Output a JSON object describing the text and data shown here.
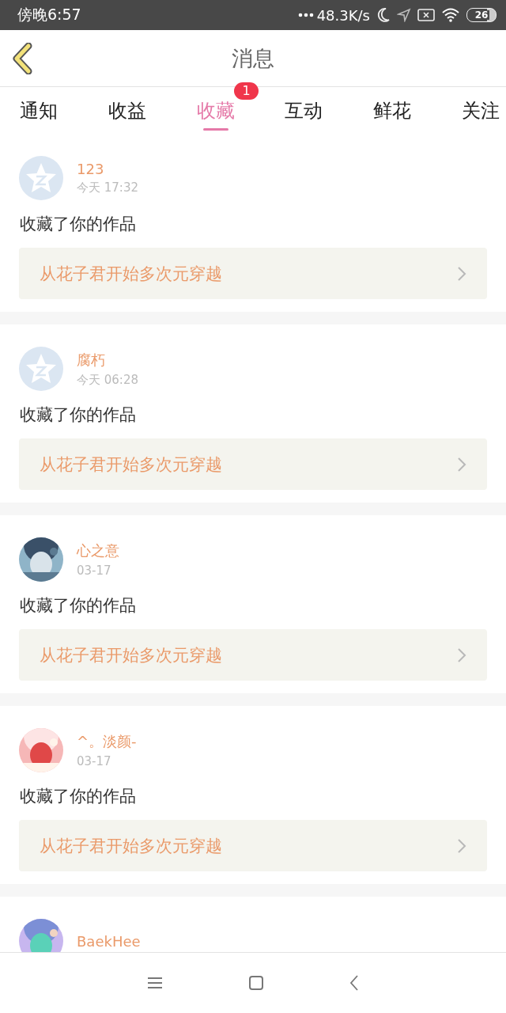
{
  "status_bar": {
    "time": "傍晚6:57",
    "speed": "48.3K/s",
    "battery": "26"
  },
  "header": {
    "title": "消息"
  },
  "tabs": [
    {
      "label": "通知",
      "selected": false
    },
    {
      "label": "收益",
      "selected": false
    },
    {
      "label": "收藏",
      "selected": true,
      "badge": "1"
    },
    {
      "label": "互动",
      "selected": false
    },
    {
      "label": "鲜花",
      "selected": false
    },
    {
      "label": "关注",
      "selected": false
    }
  ],
  "messages": [
    {
      "kind": "default",
      "name": "123",
      "time": "今天 17:32",
      "text": "收藏了你的作品",
      "work": "从花子君开始多次元穿越"
    },
    {
      "kind": "default",
      "name": "腐朽",
      "time": "今天 06:28",
      "text": "收藏了你的作品",
      "work": "从花子君开始多次元穿越"
    },
    {
      "kind": "picture",
      "name": "心之意",
      "time": "03-17",
      "text": "收藏了你的作品",
      "work": "从花子君开始多次元穿越"
    },
    {
      "kind": "picture",
      "name": "^。淡颜-",
      "time": "03-17",
      "text": "收藏了你的作品",
      "work": "从花子君开始多次元穿越"
    },
    {
      "kind": "picture",
      "name": "BaekHee"
    }
  ]
}
